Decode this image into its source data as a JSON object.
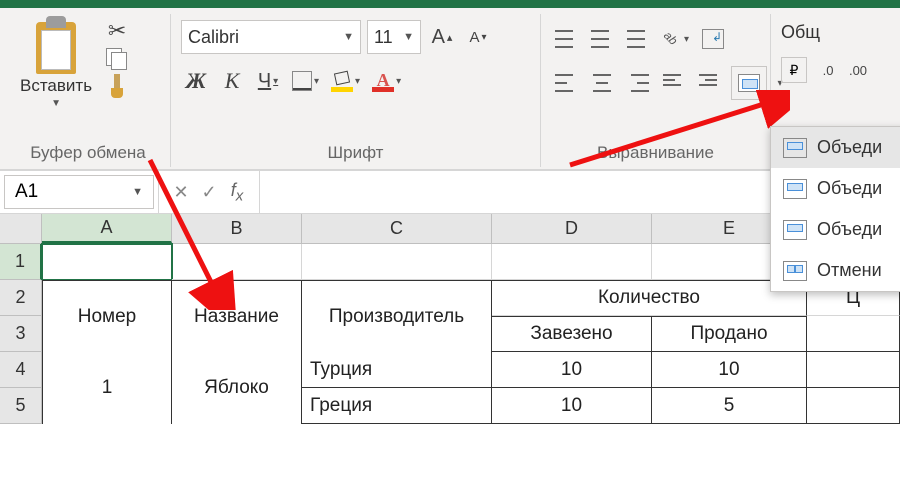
{
  "ribbon": {
    "clipboard": {
      "paste": "Вставить",
      "group_label": "Буфер обмена"
    },
    "font": {
      "name": "Calibri",
      "size": "11",
      "bold": "Ж",
      "italic": "К",
      "underline": "Ч",
      "group_label": "Шрифт"
    },
    "alignment": {
      "group_label": "Выравнивание"
    },
    "number": {
      "format": "Общ"
    },
    "merge_menu": [
      "Объеди",
      "Объеди",
      "Объеди",
      "Отмени"
    ]
  },
  "namebox": "A1",
  "colheads": [
    "A",
    "B",
    "C",
    "D",
    "E"
  ],
  "rowheads": [
    "1",
    "2",
    "3",
    "4",
    "5"
  ],
  "table": {
    "h_nomer": "Номер",
    "h_nazv": "Название",
    "h_proizv": "Производитель",
    "h_kol": "Количество",
    "h_zav": "Завезено",
    "h_prod": "Продано",
    "h_price": "Ц",
    "r1_num": "1",
    "r1_name": "Яблоко",
    "r1_p1": "Турция",
    "r1_z1": "10",
    "r1_s1": "10",
    "r1_p2": "Греция",
    "r1_z2": "10",
    "r1_s2": "5"
  }
}
